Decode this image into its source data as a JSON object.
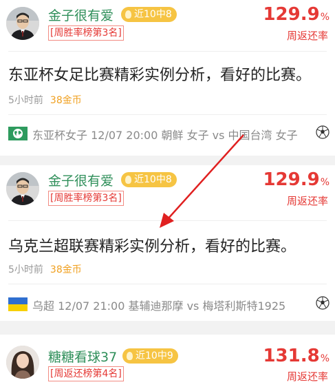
{
  "posts": [
    {
      "author": "金子很有爱",
      "streak_badge": "近10中8",
      "rank_tag": "[周胜率榜第3名]",
      "rate_value": "129.9",
      "rate_unit": "%",
      "rate_label": "周返还率",
      "title": "东亚杯女足比赛精彩实例分析，看好的比赛。",
      "time": "5小时前",
      "coins": "38金币",
      "match": {
        "flag_icon": "globe-flag-icon",
        "text": "东亚杯女子 12/07 20:00 朝鲜 女子 vs 中国台湾 女子",
        "sport_icon": "soccer-ball-icon"
      }
    },
    {
      "author": "金子很有爱",
      "streak_badge": "近10中8",
      "rank_tag": "[周胜率榜第3名]",
      "rate_value": "129.9",
      "rate_unit": "%",
      "rate_label": "周返还率",
      "title": "乌克兰超联赛精彩实例分析，看好的比赛。",
      "time": "5小时前",
      "coins": "38金币",
      "match": {
        "flag_icon": "ukraine-flag-icon",
        "text": "乌超 12/07 21:00 基辅迪那摩 vs 梅塔利斯特1925",
        "sport_icon": "soccer-ball-icon"
      }
    },
    {
      "author": "糖糖看球37",
      "streak_badge": "近10中9",
      "rank_tag": "[周返还榜第4名]",
      "rate_value": "131.8",
      "rate_unit": "%",
      "rate_label": "周返还率"
    }
  ],
  "colors": {
    "author": "#2f8f5a",
    "badge": "#f6c443",
    "rate": "#e53935",
    "coins": "#f0a020",
    "annotation_arrow": "#e02020"
  }
}
